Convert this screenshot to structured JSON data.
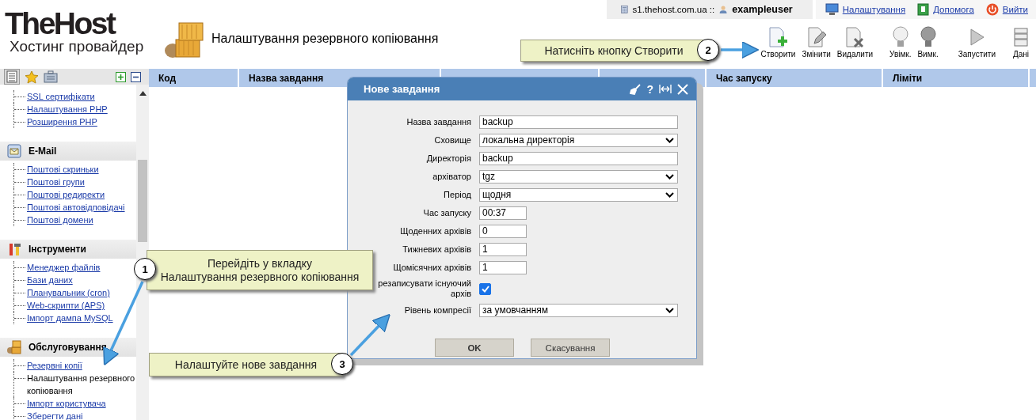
{
  "logo": {
    "title": "TheHost",
    "subtitle": "Хостинг провайдер"
  },
  "page_title": "Налаштування резервного копіювання",
  "top_bar": {
    "server": "s1.thehost.com.ua ::",
    "user": "exampleuser",
    "links": [
      {
        "label": "Налаштування"
      },
      {
        "label": "Допомога"
      },
      {
        "label": "Вийти"
      }
    ]
  },
  "toolbar": [
    {
      "label": "Створити"
    },
    {
      "label": "Змінити"
    },
    {
      "label": "Видалити"
    },
    {
      "label": "Увімк."
    },
    {
      "label": "Вимк."
    },
    {
      "label": "Запустити"
    },
    {
      "label": "Дані"
    }
  ],
  "sidebar": {
    "sections": [
      {
        "items": [
          {
            "label": "SSL сертифікати",
            "selected": false
          },
          {
            "label": "Налаштування PHP",
            "selected": false
          },
          {
            "label": "Розширення PHP",
            "selected": false
          }
        ]
      },
      {
        "title": "E-Mail",
        "items": [
          {
            "label": "Поштові скриньки",
            "selected": false
          },
          {
            "label": "Поштові групи",
            "selected": false
          },
          {
            "label": "Поштові редиректи",
            "selected": false
          },
          {
            "label": "Поштові автовідповідачі",
            "selected": false
          },
          {
            "label": "Поштові домени",
            "selected": false
          }
        ]
      },
      {
        "title": "Інструменти",
        "items": [
          {
            "label": "Менеджер файлів",
            "selected": false
          },
          {
            "label": "Бази даних",
            "selected": false
          },
          {
            "label": "Планувальник (cron)",
            "selected": false
          },
          {
            "label": "Web-скрипти (APS)",
            "selected": false
          },
          {
            "label": "Імпорт дампа MySQL",
            "selected": false
          }
        ]
      },
      {
        "title": "Обслуговування",
        "items": [
          {
            "label": "Резервні копії",
            "selected": false
          },
          {
            "label": "Налаштування резервного копіювання",
            "selected": true
          },
          {
            "label": "Імпорт користувача",
            "selected": false
          },
          {
            "label": "Зберегти дані",
            "selected": false
          }
        ]
      }
    ]
  },
  "table": {
    "columns": [
      "Код",
      "Назва завдання",
      "Час запуску",
      "Ліміти"
    ]
  },
  "dialog": {
    "title": "Нове завдання",
    "help": "?",
    "fields": [
      {
        "kind": "text",
        "label": "Назва завдання",
        "value": "backup"
      },
      {
        "kind": "select",
        "label": "Сховище",
        "value": "локальна директорія"
      },
      {
        "kind": "text",
        "label": "Директорія",
        "value": "backup"
      },
      {
        "kind": "select",
        "label": "архіватор",
        "value": "tgz"
      },
      {
        "kind": "select",
        "label": "Період",
        "value": "щодня"
      },
      {
        "kind": "short",
        "label": "Час запуску",
        "value": "00:37"
      },
      {
        "kind": "short",
        "label": "Щоденних архівів",
        "value": "0"
      },
      {
        "kind": "short",
        "label": "Тижневих архівів",
        "value": "1"
      },
      {
        "kind": "short",
        "label": "Щомісячних архівів",
        "value": "1"
      },
      {
        "kind": "checkbox",
        "label": "резаписувати існуючий архів",
        "checked": true
      },
      {
        "kind": "select",
        "label": "Рівень компресії",
        "value": "за умовчанням"
      }
    ],
    "buttons": [
      "OK",
      "Скасування"
    ]
  },
  "callouts": [
    {
      "number": "1",
      "lines": [
        "Перейдіть у вкладку",
        "Налаштування резервного копіювання"
      ]
    },
    {
      "number": "2",
      "lines": [
        "Натисніть кнопку Створити"
      ]
    },
    {
      "number": "3",
      "lines": [
        "Налаштуйте нове завдання"
      ]
    }
  ]
}
